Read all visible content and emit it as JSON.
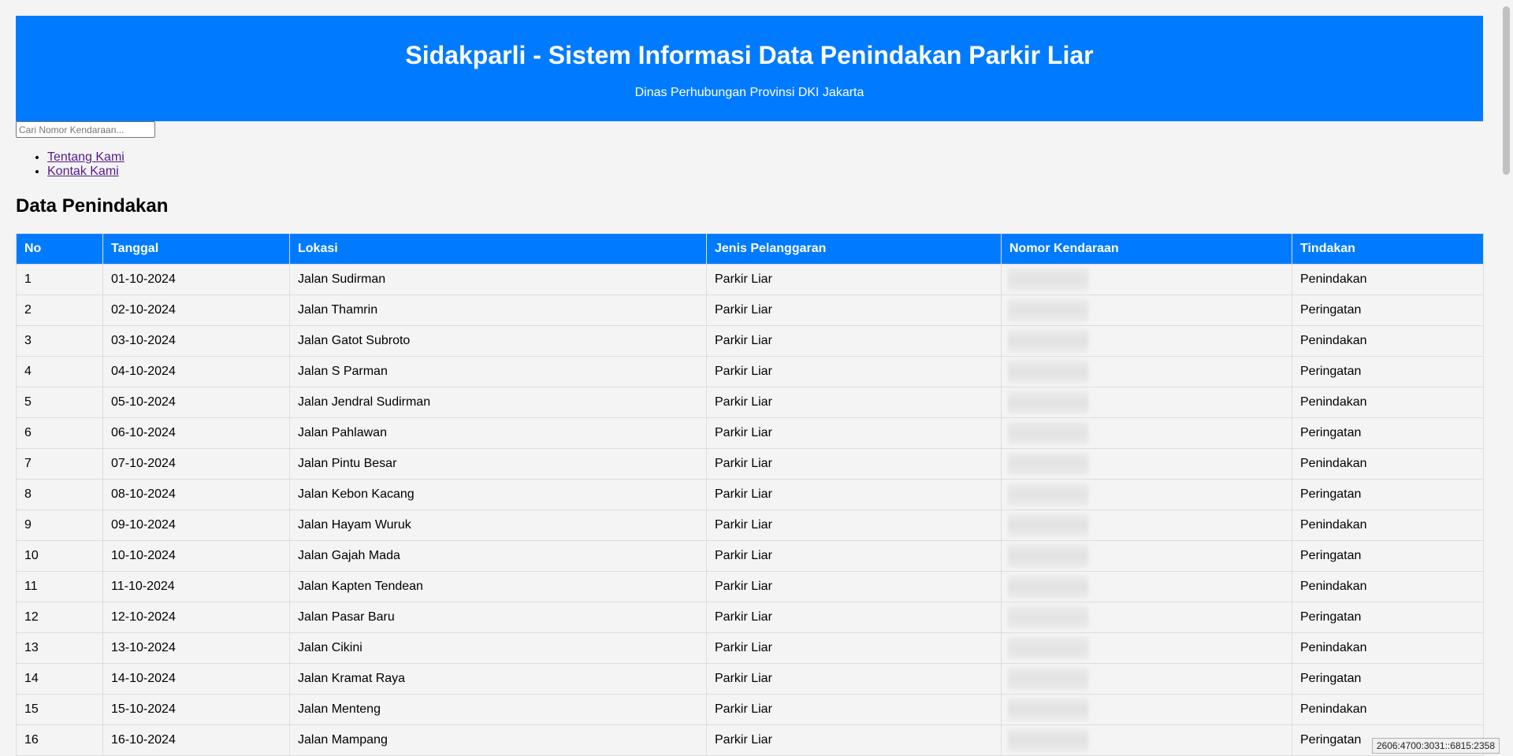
{
  "header": {
    "title": "Sidakparli - Sistem Informasi Data Penindakan Parkir Liar",
    "subtitle": "Dinas Perhubungan Provinsi DKI Jakarta"
  },
  "search": {
    "placeholder": "Cari Nomor Kendaraan...",
    "value": ""
  },
  "nav": {
    "items": [
      {
        "label": "Tentang Kami"
      },
      {
        "label": "Kontak Kami"
      }
    ]
  },
  "section": {
    "title": "Data Penindakan"
  },
  "table": {
    "columns": [
      "No",
      "Tanggal",
      "Lokasi",
      "Jenis Pelanggaran",
      "Nomor Kendaraan",
      "Tindakan"
    ],
    "rows": [
      {
        "no": "1",
        "tanggal": "01-10-2024",
        "lokasi": "Jalan Sudirman",
        "jenis": "Parkir Liar",
        "tindakan": "Penindakan"
      },
      {
        "no": "2",
        "tanggal": "02-10-2024",
        "lokasi": "Jalan Thamrin",
        "jenis": "Parkir Liar",
        "tindakan": "Peringatan"
      },
      {
        "no": "3",
        "tanggal": "03-10-2024",
        "lokasi": "Jalan Gatot Subroto",
        "jenis": "Parkir Liar",
        "tindakan": "Penindakan"
      },
      {
        "no": "4",
        "tanggal": "04-10-2024",
        "lokasi": "Jalan S Parman",
        "jenis": "Parkir Liar",
        "tindakan": "Peringatan"
      },
      {
        "no": "5",
        "tanggal": "05-10-2024",
        "lokasi": "Jalan Jendral Sudirman",
        "jenis": "Parkir Liar",
        "tindakan": "Penindakan"
      },
      {
        "no": "6",
        "tanggal": "06-10-2024",
        "lokasi": "Jalan Pahlawan",
        "jenis": "Parkir Liar",
        "tindakan": "Peringatan"
      },
      {
        "no": "7",
        "tanggal": "07-10-2024",
        "lokasi": "Jalan Pintu Besar",
        "jenis": "Parkir Liar",
        "tindakan": "Penindakan"
      },
      {
        "no": "8",
        "tanggal": "08-10-2024",
        "lokasi": "Jalan Kebon Kacang",
        "jenis": "Parkir Liar",
        "tindakan": "Peringatan"
      },
      {
        "no": "9",
        "tanggal": "09-10-2024",
        "lokasi": "Jalan Hayam Wuruk",
        "jenis": "Parkir Liar",
        "tindakan": "Penindakan"
      },
      {
        "no": "10",
        "tanggal": "10-10-2024",
        "lokasi": "Jalan Gajah Mada",
        "jenis": "Parkir Liar",
        "tindakan": "Peringatan"
      },
      {
        "no": "11",
        "tanggal": "11-10-2024",
        "lokasi": "Jalan Kapten Tendean",
        "jenis": "Parkir Liar",
        "tindakan": "Penindakan"
      },
      {
        "no": "12",
        "tanggal": "12-10-2024",
        "lokasi": "Jalan Pasar Baru",
        "jenis": "Parkir Liar",
        "tindakan": "Peringatan"
      },
      {
        "no": "13",
        "tanggal": "13-10-2024",
        "lokasi": "Jalan Cikini",
        "jenis": "Parkir Liar",
        "tindakan": "Penindakan"
      },
      {
        "no": "14",
        "tanggal": "14-10-2024",
        "lokasi": "Jalan Kramat Raya",
        "jenis": "Parkir Liar",
        "tindakan": "Peringatan"
      },
      {
        "no": "15",
        "tanggal": "15-10-2024",
        "lokasi": "Jalan Menteng",
        "jenis": "Parkir Liar",
        "tindakan": "Penindakan"
      },
      {
        "no": "16",
        "tanggal": "16-10-2024",
        "lokasi": "Jalan Mampang",
        "jenis": "Parkir Liar",
        "tindakan": "Peringatan"
      }
    ]
  },
  "status_bar": {
    "text": "2606:4700:3031::6815:2358"
  }
}
